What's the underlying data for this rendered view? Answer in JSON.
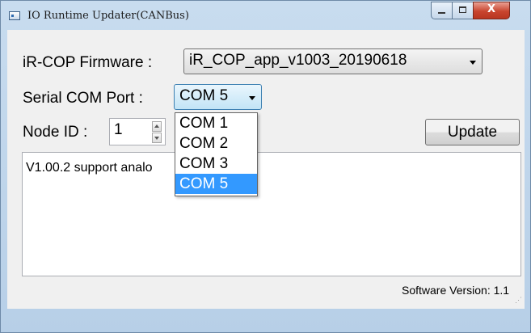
{
  "window": {
    "title": "IO Runtime Updater(CANBus)",
    "close_glyph": "X"
  },
  "firmware": {
    "label": "iR-COP Firmware :",
    "selected": "iR_COP_app_v1003_20190618"
  },
  "com_port": {
    "label": "Serial COM Port :",
    "selected": "COM 5",
    "options": [
      "COM 1",
      "COM 2",
      "COM 3",
      "COM 5"
    ],
    "highlighted_index": 3
  },
  "node_id": {
    "label": "Node ID :",
    "value": "1"
  },
  "update_button": "Update",
  "log_text": "V1.00.2 support analo",
  "software_version": "Software Version: 1.1",
  "colors": {
    "highlight": "#3399ff",
    "close_button": "#c8452f"
  },
  "icons": [
    "app-icon",
    "minimize-icon",
    "maximize-icon",
    "close-icon",
    "chevron-down-icon",
    "spin-up-icon",
    "spin-down-icon",
    "resize-grip-icon"
  ]
}
